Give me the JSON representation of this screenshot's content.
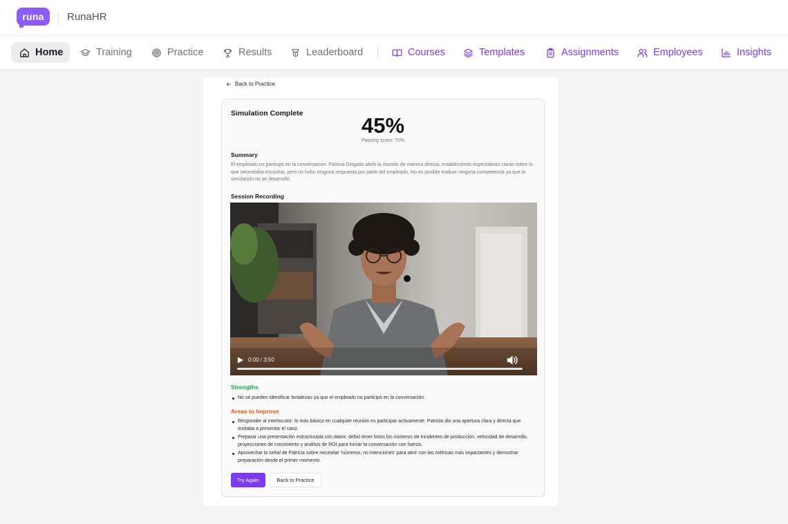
{
  "brand": {
    "logo_text": "runa",
    "name": "RunaHR"
  },
  "nav": {
    "items": [
      {
        "label": "Home",
        "icon": "home-icon",
        "active": true
      },
      {
        "label": "Training",
        "icon": "graduation-cap-icon"
      },
      {
        "label": "Practice",
        "icon": "target-icon"
      },
      {
        "label": "Results",
        "icon": "trophy-icon"
      },
      {
        "label": "Leaderboard",
        "icon": "award-icon"
      },
      {
        "label": "Courses",
        "icon": "book-open-icon"
      },
      {
        "label": "Templates",
        "icon": "layers-icon"
      },
      {
        "label": "Assignments",
        "icon": "clipboard-icon"
      },
      {
        "label": "Employees",
        "icon": "users-icon"
      },
      {
        "label": "Insights",
        "icon": "bar-chart-icon"
      }
    ],
    "admin_color": "#7c3aed"
  },
  "page": {
    "back_link": "Back to Practice",
    "card": {
      "title": "Simulation Complete",
      "score": "45%",
      "score_value": 0.45,
      "passing": "Passing score: 70%",
      "summary_heading": "Summary",
      "summary_text": "El empleado no participó en la conversación. Patricia Delgado abrió la reunión de manera directa, estableciendo expectativas claras sobre lo que necesitaba escuchar, pero no hubo ninguna respuesta por parte del empleado. No es posible evaluar ninguna competencia ya que la simulación no se desarrolló.",
      "recording_heading": "Session Recording",
      "video": {
        "time": "0:00 / 3:50",
        "progress": 0.0
      },
      "strengths_heading": "Strengths",
      "strengths": [
        "No se pueden identificar fortalezas ya que el empleado no participó en la conversación."
      ],
      "areas_heading": "Areas to Improve",
      "areas": [
        "Responder al interlocutor: lo más básico en cualquier reunión es participar activamente. Patricia dio una apertura clara y directa que invitaba a presentar el caso.",
        "Preparar una presentación estructurada con datos: debió tener listos los números de incidentes de producción, velocidad de desarrollo, proyecciones de crecimiento y análisis de ROI para iniciar la conversación con fuerza.",
        "Aprovechar la señal de Patricia sobre necesitar 'números, no intenciones' para abrir con las métricas más impactantes y demostrar preparación desde el primer momento."
      ],
      "try_again_label": "Try Again",
      "back_label": "Back to Practice"
    }
  },
  "colors": {
    "accent": "#7c3aed",
    "strengths": "#16a34a",
    "areas": "#ea580c"
  }
}
